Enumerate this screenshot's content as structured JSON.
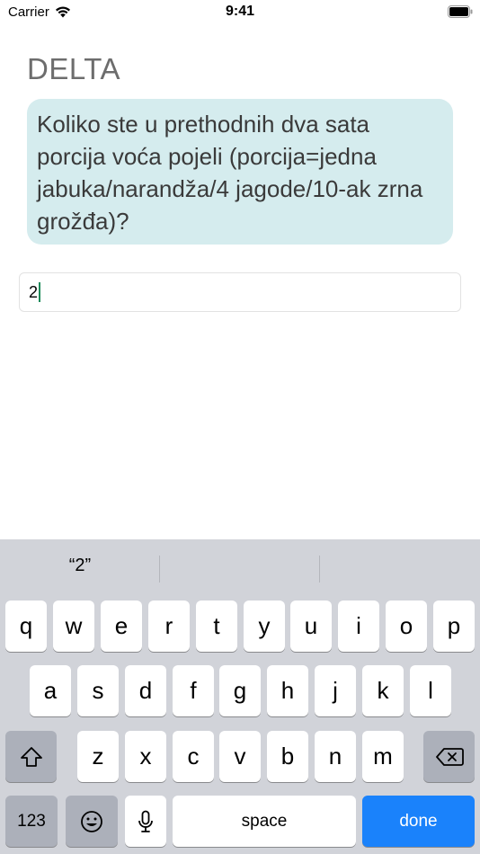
{
  "status_bar": {
    "carrier": "Carrier",
    "time": "9:41"
  },
  "app": {
    "title": "DELTA",
    "question": "Koliko ste u prethodnih dva sata porcija voća pojeli (porcija=jedna jabuka/narandža/4 jagode/10-ak zrna grožđa)?",
    "answer_value": "2"
  },
  "keyboard": {
    "suggestions": [
      "“2”",
      "",
      ""
    ],
    "row1": [
      "q",
      "w",
      "e",
      "r",
      "t",
      "y",
      "u",
      "i",
      "o",
      "p"
    ],
    "row2": [
      "a",
      "s",
      "d",
      "f",
      "g",
      "h",
      "j",
      "k",
      "l"
    ],
    "row3": [
      "z",
      "x",
      "c",
      "v",
      "b",
      "n",
      "m"
    ],
    "numbers_label": "123",
    "space_label": "space",
    "done_label": "done",
    "done_color": "#1a82fb",
    "icons": {
      "shift": "shift-icon",
      "backspace": "backspace-icon",
      "emoji": "emoji-icon",
      "mic": "microphone-icon"
    }
  },
  "colors": {
    "bubble": "#d5ecee",
    "title": "#6d6d6d",
    "caret": "#1e8a5a",
    "keyboard_bg": "#d1d3d9"
  }
}
